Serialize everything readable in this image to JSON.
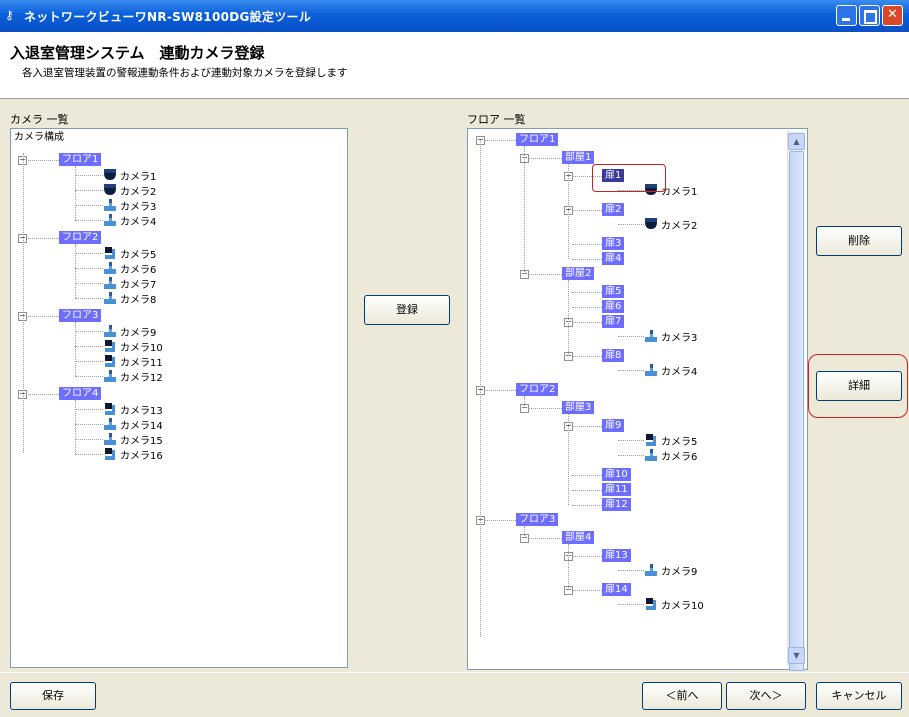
{
  "window": {
    "title": "ネットワークビューワNR-SW8100DG設定ツール"
  },
  "header": {
    "title": "入退室管理システム　連動カメラ登録",
    "description": "各入退室管理装置の警報連動条件および連動対象カメラを登録します"
  },
  "left_panel": {
    "label": "カメラ 一覧",
    "root": "カメラ構成",
    "floors": [
      {
        "label": "フロア1",
        "cameras": [
          "カメラ1",
          "カメラ2",
          "カメラ3",
          "カメラ4"
        ]
      },
      {
        "label": "フロア2",
        "cameras": [
          "カメラ5",
          "カメラ6",
          "カメラ7",
          "カメラ8"
        ]
      },
      {
        "label": "フロア3",
        "cameras": [
          "カメラ9",
          "カメラ10",
          "カメラ11",
          "カメラ12"
        ]
      },
      {
        "label": "フロア4",
        "cameras": [
          "カメラ13",
          "カメラ14",
          "カメラ15",
          "カメラ16"
        ]
      }
    ]
  },
  "right_panel": {
    "label": "フロア 一覧",
    "floors": [
      {
        "label": "フロア1",
        "rooms": [
          {
            "label": "部屋1",
            "doors": [
              {
                "label": "扉1",
                "cameras": [
                  "カメラ1"
                ]
              },
              {
                "label": "扉2",
                "cameras": [
                  "カメラ2"
                ]
              },
              {
                "label": "扉3",
                "cameras": []
              },
              {
                "label": "扉4",
                "cameras": []
              }
            ]
          },
          {
            "label": "部屋2",
            "doors": [
              {
                "label": "扉5",
                "cameras": []
              },
              {
                "label": "扉6",
                "cameras": []
              },
              {
                "label": "扉7",
                "cameras": [
                  "カメラ3"
                ]
              },
              {
                "label": "扉8",
                "cameras": [
                  "カメラ4"
                ]
              }
            ]
          }
        ]
      },
      {
        "label": "フロア2",
        "rooms": [
          {
            "label": "部屋3",
            "doors": [
              {
                "label": "扉9",
                "cameras": [
                  "カメラ5",
                  "カメラ6"
                ]
              },
              {
                "label": "扉10",
                "cameras": []
              },
              {
                "label": "扉11",
                "cameras": []
              },
              {
                "label": "扉12",
                "cameras": []
              }
            ]
          }
        ]
      },
      {
        "label": "フロア3",
        "rooms": [
          {
            "label": "部屋4",
            "doors": [
              {
                "label": "扉13",
                "cameras": [
                  "カメラ9"
                ]
              },
              {
                "label": "扉14",
                "cameras": [
                  "カメラ10"
                ]
              }
            ]
          }
        ]
      }
    ]
  },
  "buttons": {
    "register": "登録",
    "delete": "削除",
    "detail": "詳細",
    "save": "保存",
    "prev": "＜前へ",
    "next": "次へ＞",
    "cancel": "キャンセル"
  },
  "colors": {
    "accent": "#6d6dff",
    "highlight_box": "#d02020",
    "titlebar": "#0a5fd9"
  }
}
